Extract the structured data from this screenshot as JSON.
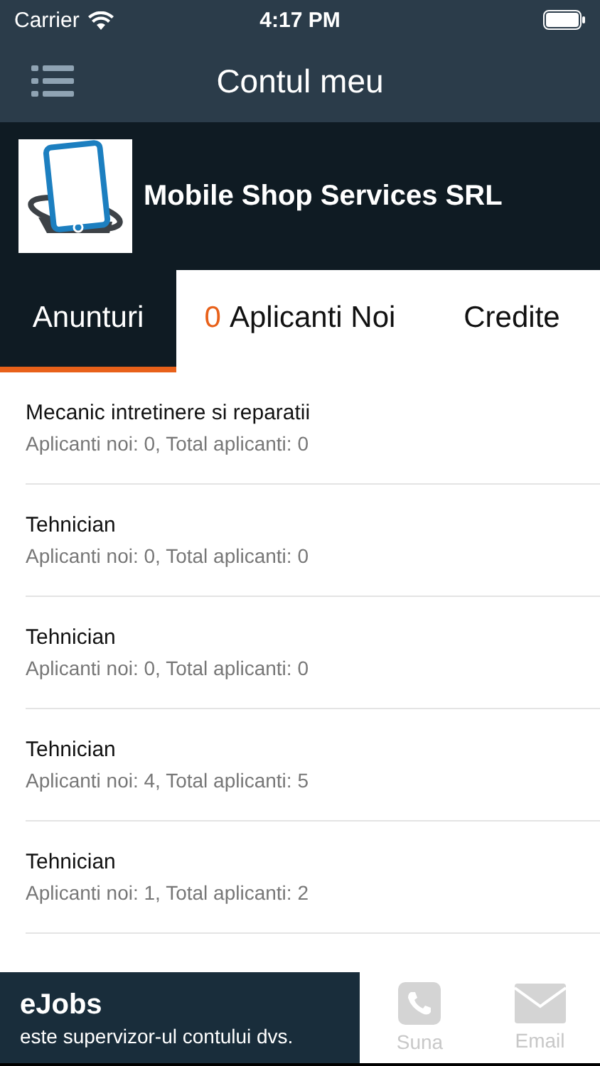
{
  "status_bar": {
    "carrier": "Carrier",
    "time": "4:17 PM"
  },
  "nav": {
    "title": "Contul meu"
  },
  "company": {
    "name": "Mobile Shop Services SRL"
  },
  "tabs": [
    {
      "label": "Anunturi",
      "selected": true
    },
    {
      "count": "0",
      "label": "Aplicanti Noi",
      "selected": false
    },
    {
      "label": "Credite",
      "selected": false
    }
  ],
  "jobs": [
    {
      "title": "Mecanic intretinere si reparatii",
      "stats": "Aplicanti noi: 0, Total aplicanti: 0"
    },
    {
      "title": "Tehnician",
      "stats": "Aplicanti noi: 0, Total aplicanti: 0"
    },
    {
      "title": "Tehnician",
      "stats": "Aplicanti noi: 0, Total aplicanti: 0"
    },
    {
      "title": "Tehnician",
      "stats": "Aplicanti noi: 4, Total aplicanti: 5"
    },
    {
      "title": "Tehnician",
      "stats": "Aplicanti noi: 1, Total aplicanti: 2"
    }
  ],
  "supervisor": {
    "name": "eJobs",
    "note": "este supervizor-ul contului dvs."
  },
  "actions": [
    {
      "kind": "phone",
      "label": "Suna",
      "disabled": true
    },
    {
      "kind": "email",
      "label": "Email",
      "disabled": true
    }
  ]
}
